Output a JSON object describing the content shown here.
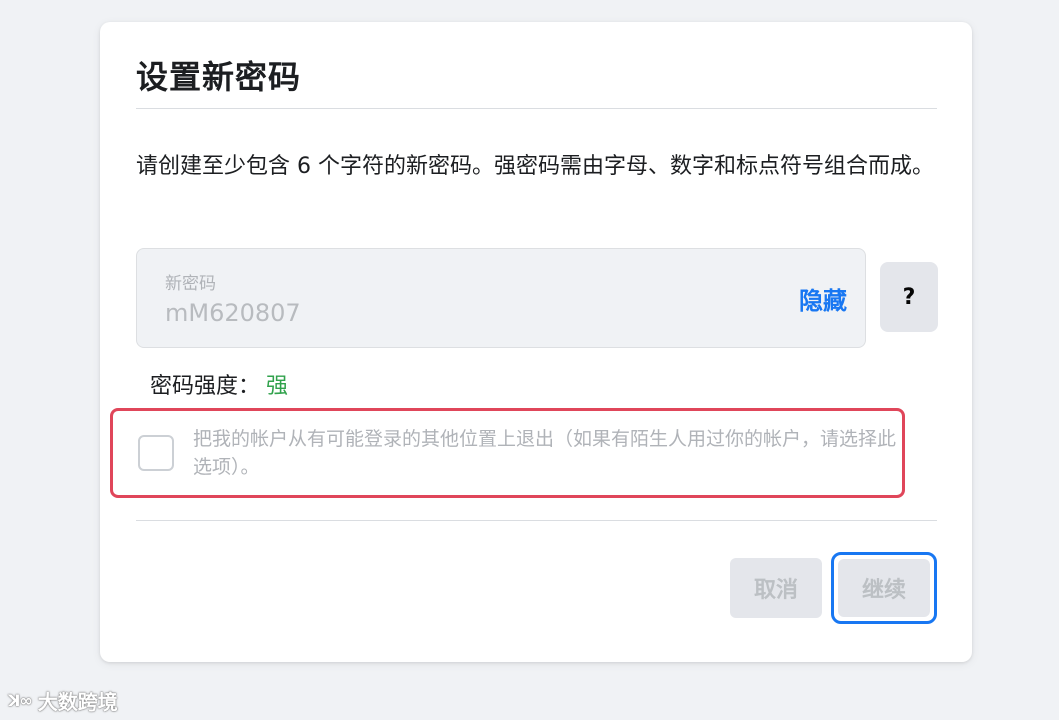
{
  "dialog": {
    "title": "设置新密码",
    "description": "请创建至少包含 6 个字符的新密码。强密码需由字母、数字和标点符号组合而成。"
  },
  "password_field": {
    "label": "新密码",
    "value": "mM620807",
    "toggle_label": "隐藏"
  },
  "help_button": {
    "label": "?"
  },
  "strength": {
    "label": "密码强度：",
    "value": "强",
    "value_color": "#31a24c"
  },
  "logout_option": {
    "checked": false,
    "text": "把我的帐户从有可能登录的其他位置上退出（如果有陌生人用过你的帐户，请选择此选项）。",
    "highlight_color": "#e0465a"
  },
  "buttons": {
    "cancel_label": "取消",
    "continue_label": "继续"
  },
  "watermark": {
    "logo": "ꓘ∞",
    "text": "大数跨境"
  },
  "colors": {
    "accent": "#1877f2",
    "background": "#f0f2f5"
  }
}
